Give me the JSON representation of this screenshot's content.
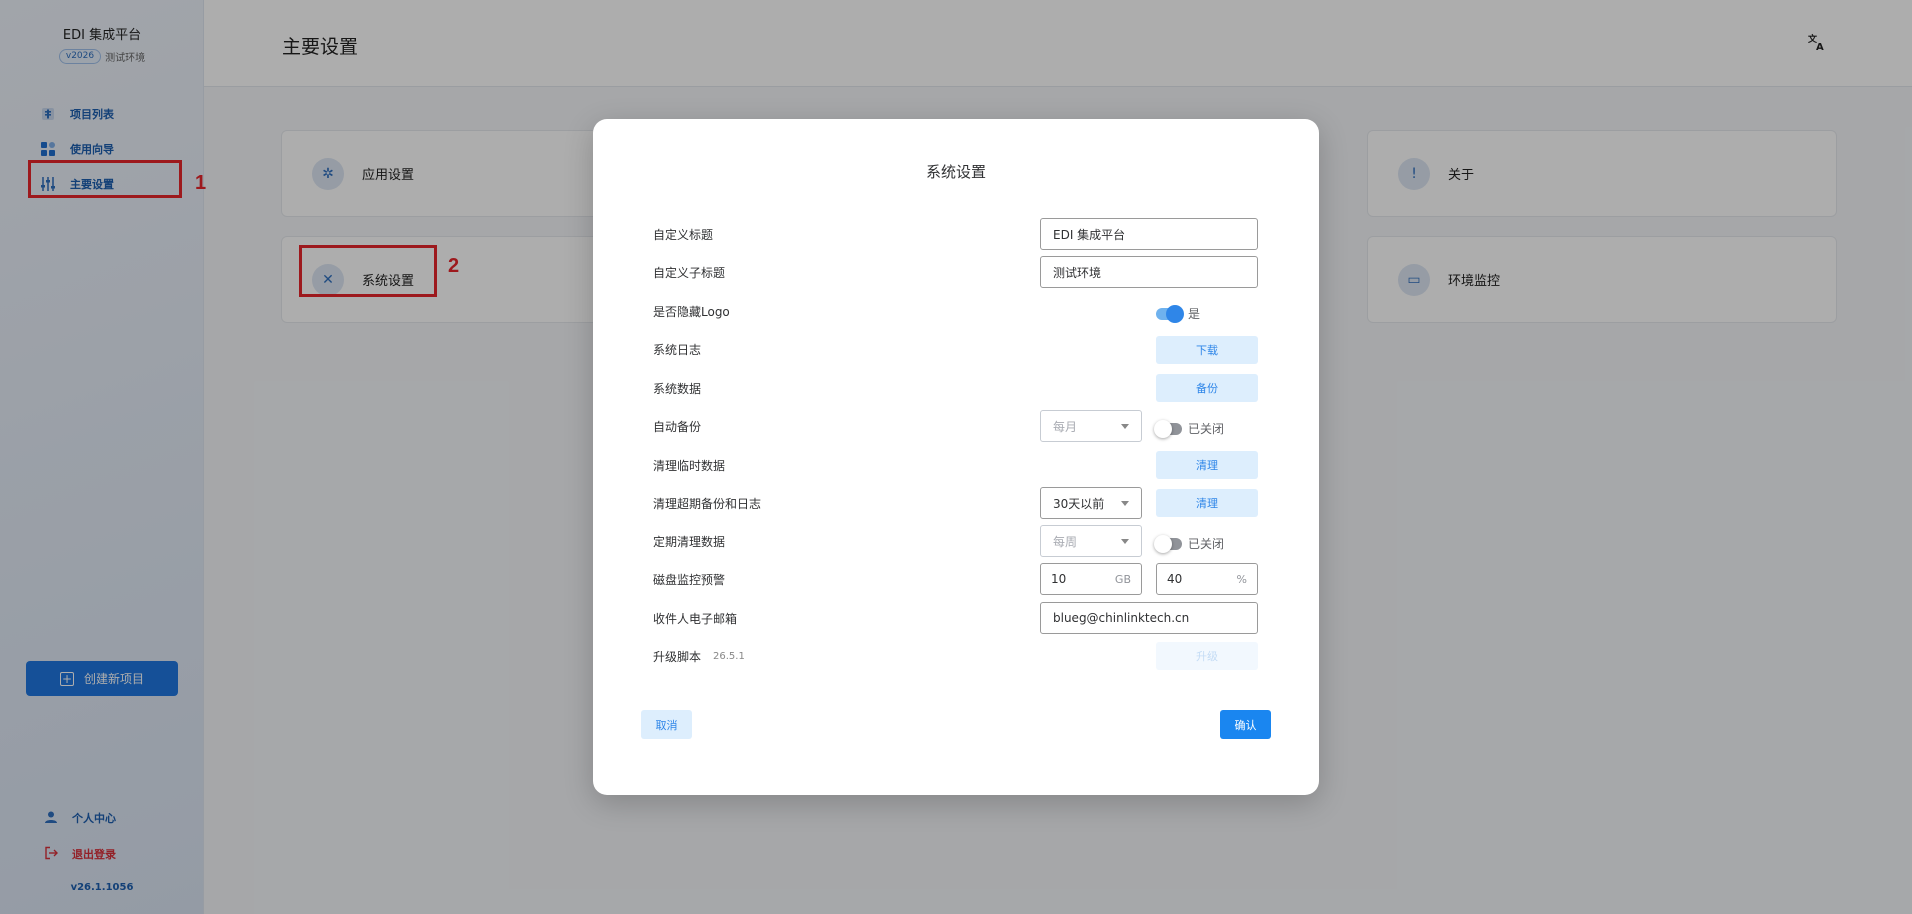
{
  "sidebar": {
    "brand_title": "EDI 集成平台",
    "version_badge": "v2026",
    "env_label": "测试环境",
    "items": [
      {
        "label": "项目列表"
      },
      {
        "label": "使用向导"
      },
      {
        "label": "主要设置"
      }
    ],
    "create_label": "创建新项目",
    "user_center": "个人中心",
    "logout": "退出登录",
    "system_version": "v26.1.1056"
  },
  "annotations": {
    "step1": "1",
    "step2": "2"
  },
  "header": {
    "title": "主要设置"
  },
  "cards": {
    "app_settings": "应用设置",
    "system_settings": "系统设置",
    "about": "关于",
    "env_monitor": "环境监控"
  },
  "dialog": {
    "title": "系统设置",
    "rows": {
      "custom_title": {
        "label": "自定义标题",
        "value": "EDI 集成平台"
      },
      "custom_subtitle": {
        "label": "自定义子标题",
        "value": "测试环境"
      },
      "hide_logo": {
        "label": "是否隐藏Logo",
        "state_text": "是"
      },
      "system_log": {
        "label": "系统日志",
        "button": "下载"
      },
      "system_data": {
        "label": "系统数据",
        "button": "备份"
      },
      "auto_backup": {
        "label": "自动备份",
        "select": "每月",
        "state_text": "已关闭"
      },
      "clean_temp": {
        "label": "清理临时数据",
        "button": "清理"
      },
      "clean_expired": {
        "label": "清理超期备份和日志",
        "select": "30天以前",
        "button": "清理"
      },
      "scheduled_clean": {
        "label": "定期清理数据",
        "select": "每周",
        "state_text": "已关闭"
      },
      "disk_monitor": {
        "label": "磁盘监控预警",
        "gb_value": "10",
        "gb_unit": "GB",
        "pct_value": "40",
        "pct_unit": "%"
      },
      "recipient_email": {
        "label": "收件人电子邮箱",
        "value": "blueg@chinlinktech.cn"
      },
      "upgrade_script": {
        "label": "升级脚本",
        "version": "26.5.1",
        "button": "升级"
      }
    },
    "cancel": "取消",
    "confirm": "确认"
  },
  "colors": {
    "primary": "#1a86f0",
    "highlight": "#e8262b",
    "light_button_bg": "#ddeefd"
  }
}
